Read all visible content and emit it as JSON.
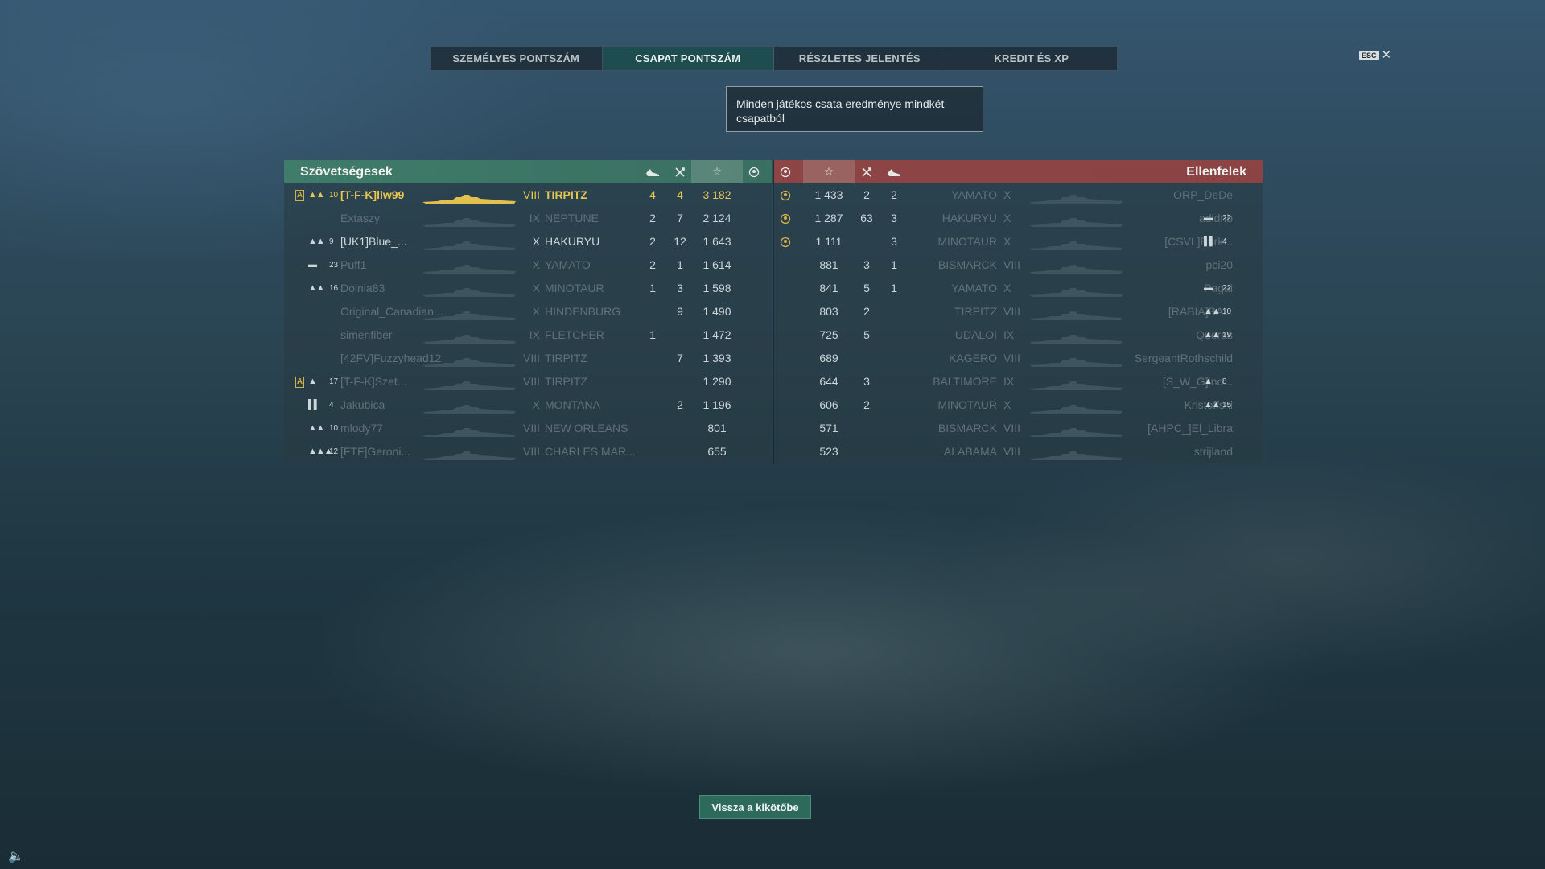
{
  "tabs": [
    {
      "label": "SZEMÉLYES PONTSZÁM",
      "active": false
    },
    {
      "label": "CSAPAT PONTSZÁM",
      "active": true
    },
    {
      "label": "RÉSZLETES JELENTÉS",
      "active": false
    },
    {
      "label": "KREDIT ÉS XP",
      "active": false
    }
  ],
  "esc": {
    "key": "ESC",
    "close": "✕"
  },
  "tooltip": "Minden játékos csata eredménye mindkét csapatból",
  "allies": {
    "title": "Szövetségesek",
    "header_icons": [
      "ship-kills-icon",
      "plane-kills-icon",
      "base-xp-star-icon",
      "ribbon-icon"
    ],
    "players": [
      {
        "a": true,
        "rank_icon": "▲▲",
        "rank": "10",
        "name": "[T-F-K]llw99",
        "tier": "VIII",
        "ship": "TIRPITZ",
        "c1": "4",
        "c2": "4",
        "xp": "3 182",
        "style": "gold"
      },
      {
        "a": false,
        "rank_icon": "",
        "rank": "",
        "name": "Extaszy",
        "tier": "IX",
        "ship": "NEPTUNE",
        "c1": "2",
        "c2": "7",
        "xp": "2 124",
        "style": "dim"
      },
      {
        "a": false,
        "rank_icon": "▲▲",
        "rank": "9",
        "name": "[UK1]Blue_...",
        "tier": "X",
        "ship": "HAKURYU",
        "c1": "2",
        "c2": "12",
        "xp": "1 643",
        "style": "bright"
      },
      {
        "a": false,
        "rank_icon": "▬",
        "rank": "23",
        "name": "Puff1",
        "tier": "X",
        "ship": "YAMATO",
        "c1": "2",
        "c2": "1",
        "xp": "1 614",
        "style": "dim"
      },
      {
        "a": false,
        "rank_icon": "▲▲",
        "rank": "16",
        "name": "Dolnia83",
        "tier": "X",
        "ship": "MINOTAUR",
        "c1": "1",
        "c2": "3",
        "xp": "1 598",
        "style": "dim"
      },
      {
        "a": false,
        "rank_icon": "",
        "rank": "",
        "name": "Original_Canadian...",
        "tier": "X",
        "ship": "HINDENBURG",
        "c1": "",
        "c2": "9",
        "xp": "1 490",
        "style": "dim"
      },
      {
        "a": false,
        "rank_icon": "",
        "rank": "",
        "name": "simenfiber",
        "tier": "IX",
        "ship": "FLETCHER",
        "c1": "1",
        "c2": "",
        "xp": "1 472",
        "style": "dim"
      },
      {
        "a": false,
        "rank_icon": "",
        "rank": "",
        "name": "[42FV]Fuzzyhead12",
        "tier": "VIII",
        "ship": "TIRPITZ",
        "c1": "",
        "c2": "7",
        "xp": "1 393",
        "style": "dim"
      },
      {
        "a": true,
        "rank_icon": "▲",
        "rank": "17",
        "name": "[T-F-K]Szet...",
        "tier": "VIII",
        "ship": "TIRPITZ",
        "c1": "",
        "c2": "",
        "xp": "1 290",
        "style": "dim"
      },
      {
        "a": false,
        "rank_icon": "▌▌",
        "rank": "4",
        "name": "Jakubica",
        "tier": "X",
        "ship": "MONTANA",
        "c1": "",
        "c2": "2",
        "xp": "1 196",
        "style": "dim"
      },
      {
        "a": false,
        "rank_icon": "▲▲",
        "rank": "10",
        "name": "mlody77",
        "tier": "VIII",
        "ship": "NEW ORLEANS",
        "c1": "",
        "c2": "",
        "xp": "801",
        "style": "dim"
      },
      {
        "a": false,
        "rank_icon": "▲▲▲",
        "rank": "12",
        "name": "[FTF]Geroni...",
        "tier": "VIII",
        "ship": "CHARLES MAR...",
        "c1": "",
        "c2": "",
        "xp": "655",
        "style": "dim"
      }
    ]
  },
  "enemies": {
    "title": "Ellenfelek",
    "header_icons": [
      "ribbon-icon",
      "base-xp-star-icon",
      "plane-kills-icon",
      "ship-kills-icon"
    ],
    "players": [
      {
        "ribbon": true,
        "xp": "1 433",
        "c2": "2",
        "c1": "2",
        "ship": "YAMATO",
        "tier": "X",
        "name": "ORP_DeDe",
        "rank_icon": "",
        "rank": "",
        "style": "dim"
      },
      {
        "ribbon": true,
        "xp": "1 287",
        "c2": "63",
        "c1": "3",
        "ship": "HAKURYU",
        "tier": "X",
        "name": "adidnb",
        "rank_icon": "▬",
        "rank": "22",
        "style": "dim"
      },
      {
        "ribbon": true,
        "xp": "1 111",
        "c2": "",
        "c1": "3",
        "ship": "MINOTAUR",
        "tier": "X",
        "name": "[CSVL]Burk...",
        "rank_icon": "▌▌",
        "rank": "4",
        "style": "dim"
      },
      {
        "ribbon": false,
        "xp": "881",
        "c2": "3",
        "c1": "1",
        "ship": "BISMARCK",
        "tier": "VIII",
        "name": "pci20",
        "rank_icon": "",
        "rank": "",
        "style": "dim"
      },
      {
        "ribbon": false,
        "xp": "841",
        "c2": "5",
        "c1": "1",
        "ship": "YAMATO",
        "tier": "X",
        "name": "Pagai",
        "rank_icon": "▬",
        "rank": "22",
        "style": "dim"
      },
      {
        "ribbon": false,
        "xp": "803",
        "c2": "2",
        "c1": "",
        "ship": "TIRPITZ",
        "tier": "VIII",
        "name": "[RABIA]BA...",
        "rank_icon": "▲▲",
        "rank": "10",
        "style": "dim"
      },
      {
        "ribbon": false,
        "xp": "725",
        "c2": "5",
        "c1": "",
        "ship": "UDALOI",
        "tier": "IX",
        "name": "Queras",
        "rank_icon": "▲▲",
        "rank": "19",
        "style": "dim"
      },
      {
        "ribbon": false,
        "xp": "689",
        "c2": "",
        "c1": "",
        "ship": "KAGERO",
        "tier": "VIII",
        "name": "SergeantRothschild",
        "rank_icon": "",
        "rank": "",
        "style": "dim"
      },
      {
        "ribbon": false,
        "xp": "644",
        "c2": "3",
        "c1": "",
        "ship": "BALTIMORE",
        "tier": "IX",
        "name": "[S_W_G]ind...",
        "rank_icon": "▲",
        "rank": "8",
        "style": "dim"
      },
      {
        "ribbon": false,
        "xp": "606",
        "c2": "2",
        "c1": "",
        "ship": "MINOTAUR",
        "tier": "X",
        "name": "Kristoffski",
        "rank_icon": "▲▲",
        "rank": "15",
        "style": "dim"
      },
      {
        "ribbon": false,
        "xp": "571",
        "c2": "",
        "c1": "",
        "ship": "BISMARCK",
        "tier": "VIII",
        "name": "[AHPC_]El_Libra",
        "rank_icon": "",
        "rank": "",
        "style": "dim"
      },
      {
        "ribbon": false,
        "xp": "523",
        "c2": "",
        "c1": "",
        "ship": "ALABAMA",
        "tier": "VIII",
        "name": "strijland",
        "rank_icon": "",
        "rank": "",
        "style": "dim"
      }
    ]
  },
  "back_button": "Vissza a kikötőbe",
  "colors": {
    "ally_header": "#3f7c69",
    "enemy_header": "#8c4444",
    "highlight": "#e6c650",
    "active_tab": "#1f4d4f"
  }
}
